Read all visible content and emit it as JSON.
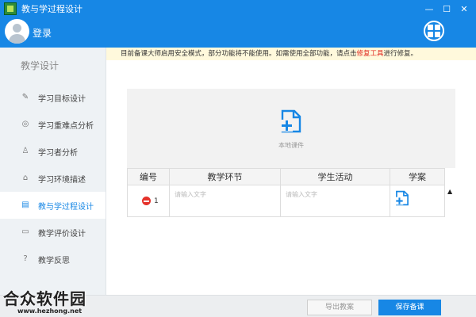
{
  "window": {
    "title": "教与学过程设计",
    "minimize_glyph": "—",
    "maximize_glyph": "☐",
    "close_glyph": "✕"
  },
  "header": {
    "login_label": "登录"
  },
  "sidebar": {
    "title": "教学设计",
    "items": [
      {
        "label": "学习目标设计",
        "icon": "edit-icon",
        "glyph": "✎"
      },
      {
        "label": "学习重难点分析",
        "icon": "target-icon",
        "glyph": "◎"
      },
      {
        "label": "学习者分析",
        "icon": "users-icon",
        "glyph": "♙"
      },
      {
        "label": "学习环境描述",
        "icon": "home-icon",
        "glyph": "⌂"
      },
      {
        "label": "教与学过程设计",
        "icon": "document-icon",
        "glyph": "▤",
        "active": true
      },
      {
        "label": "教学评价设计",
        "icon": "chat-icon",
        "glyph": "▭"
      },
      {
        "label": "教学反思",
        "icon": "help-icon",
        "glyph": "?"
      }
    ]
  },
  "notice": {
    "text_before": "目前备课大师启用安全模式，部分功能将不能使用。如需使用全部功能，请点击",
    "link_text": "修复工具",
    "text_after": "进行修复。"
  },
  "upload": {
    "label": "本地课件"
  },
  "table": {
    "headers": [
      "编号",
      "教学环节",
      "学生活动",
      "学案"
    ],
    "rows": [
      {
        "number": "1",
        "step_placeholder": "请输入文字",
        "activity_placeholder": "请输入文字"
      }
    ]
  },
  "footer": {
    "export_label": "导出教案",
    "save_label": "保存备课"
  },
  "watermark": {
    "text": "合众软件园",
    "url": "www.hezhong.net"
  },
  "colors": {
    "accent": "#1787e5",
    "danger": "#e5322b",
    "link": "#e0281e"
  }
}
